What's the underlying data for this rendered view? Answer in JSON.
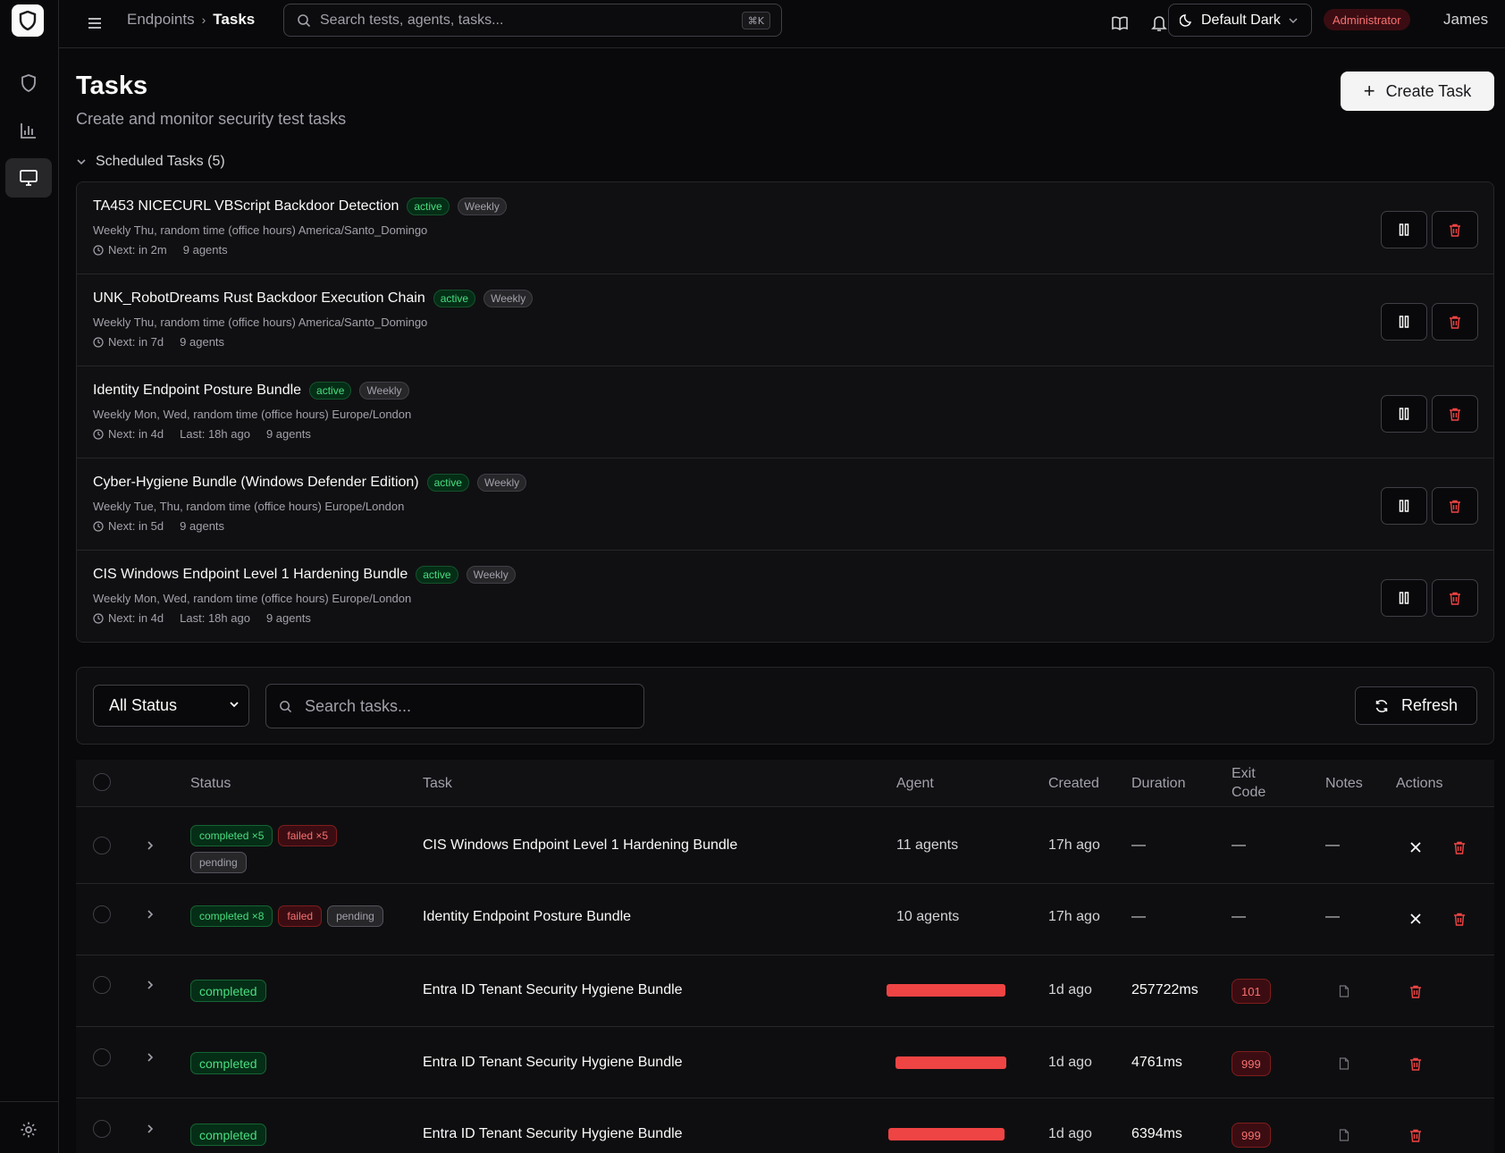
{
  "header": {
    "breadcrumb": [
      "Endpoints",
      "Tasks"
    ],
    "search_placeholder": "Search tests, agents, tasks...",
    "search_shortcut": "⌘K",
    "theme": "Default Dark",
    "role": "Administrator",
    "user": "James"
  },
  "page": {
    "title": "Tasks",
    "subtitle": "Create and monitor security test tasks",
    "create_label": "Create Task"
  },
  "scheduled": {
    "toggle_label": "Scheduled Tasks (5)",
    "items": [
      {
        "name": "TA453 NICECURL VBScript Backdoor Detection",
        "status": "active",
        "frequency": "Weekly",
        "description": "Weekly Thu, random time (office hours) America/Santo_Domingo",
        "next": "Next: in 2m",
        "last": "",
        "agents": "9 agents"
      },
      {
        "name": "UNK_RobotDreams Rust Backdoor Execution Chain",
        "status": "active",
        "frequency": "Weekly",
        "description": "Weekly Thu, random time (office hours) America/Santo_Domingo",
        "next": "Next: in 7d",
        "last": "",
        "agents": "9 agents"
      },
      {
        "name": "Identity Endpoint Posture Bundle",
        "status": "active",
        "frequency": "Weekly",
        "description": "Weekly Mon, Wed, random time (office hours) Europe/London",
        "next": "Next: in 4d",
        "last": "Last: 18h ago",
        "agents": "9 agents"
      },
      {
        "name": "Cyber-Hygiene Bundle (Windows Defender Edition)",
        "status": "active",
        "frequency": "Weekly",
        "description": "Weekly Tue, Thu, random time (office hours) Europe/London",
        "next": "Next: in 5d",
        "last": "",
        "agents": "9 agents"
      },
      {
        "name": "CIS Windows Endpoint Level 1 Hardening Bundle",
        "status": "active",
        "frequency": "Weekly",
        "description": "Weekly Mon, Wed, random time (office hours) Europe/London",
        "next": "Next: in 4d",
        "last": "Last: 18h ago",
        "agents": "9 agents"
      }
    ]
  },
  "filters": {
    "status_value": "All Status",
    "search_placeholder": "Search tasks...",
    "refresh_label": "Refresh"
  },
  "table": {
    "columns": {
      "status": "Status",
      "task": "Task",
      "agent": "Agent",
      "created": "Created",
      "duration": "Duration",
      "exit_code_1": "Exit",
      "exit_code_2": "Code",
      "notes": "Notes",
      "actions": "Actions"
    },
    "rows": [
      {
        "badges": [
          {
            "t": "completed",
            "l": "completed ×5"
          },
          {
            "t": "failed",
            "l": "failed ×5"
          },
          {
            "t": "pending",
            "l": "pending"
          }
        ],
        "task": "CIS Windows Endpoint Level 1 Hardening Bundle",
        "agent": "11 agents",
        "created": "17h ago",
        "duration": "—",
        "exit": "—",
        "notes": "—"
      },
      {
        "badges": [
          {
            "t": "completed",
            "l": "completed ×8"
          },
          {
            "t": "failed",
            "l": "failed"
          },
          {
            "t": "pending",
            "l": "pending"
          }
        ],
        "task": "Identity Endpoint Posture Bundle",
        "agent": "10 agents",
        "created": "17h ago",
        "duration": "—",
        "exit": "—",
        "notes": "—"
      },
      {
        "badges": [
          {
            "t": "completed",
            "l": "completed"
          }
        ],
        "task": "Entra ID Tenant Security Hygiene Bundle",
        "agent": "",
        "created": "1d ago",
        "duration": "257722ms",
        "exit": "101",
        "notes": ""
      },
      {
        "badges": [
          {
            "t": "completed",
            "l": "completed"
          }
        ],
        "task": "Entra ID Tenant Security Hygiene Bundle",
        "agent": "",
        "created": "1d ago",
        "duration": "4761ms",
        "exit": "999",
        "notes": ""
      },
      {
        "badges": [
          {
            "t": "completed",
            "l": "completed"
          }
        ],
        "task": "Entra ID Tenant Security Hygiene Bundle",
        "agent": "",
        "created": "1d ago",
        "duration": "6394ms",
        "exit": "999",
        "notes": ""
      }
    ]
  }
}
